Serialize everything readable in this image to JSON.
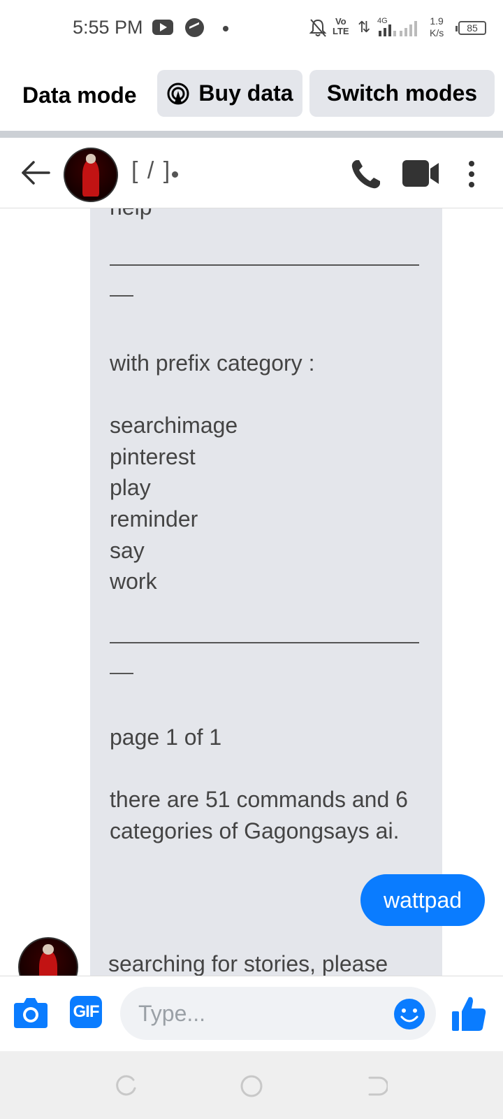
{
  "status_bar": {
    "time": "5:55 PM",
    "network_label": "Vo\nLTE",
    "network_type": "4G",
    "speed_value": "1.9",
    "speed_unit": "K/s",
    "battery": "85"
  },
  "data_mode_bar": {
    "label": "Data mode",
    "buy_data": "Buy data",
    "switch_modes": "Switch modes"
  },
  "chat_header": {
    "contact_name": "[ / ]"
  },
  "messages": {
    "bot_lines": [
      "help",
      "",
      "",
      "",
      "",
      "with prefix category :",
      "",
      "searchimage",
      "pinterest",
      "play",
      "reminder",
      "say",
      "work",
      "",
      "",
      "",
      "",
      "page 1 of 1",
      "",
      "there are 51 commands and 6",
      "categories of Gagongsays ai."
    ],
    "outgoing": "wattpad",
    "bot_reply": "searching for stories, please"
  },
  "composer": {
    "placeholder": "Type...",
    "gif_label": "GIF"
  },
  "colors": {
    "accent": "#0a7cff",
    "bubble_incoming": "#e4e6eb",
    "divider": "#ccd0d5"
  },
  "icons": [
    "youtube-icon",
    "messenger-icon",
    "bell-off-icon",
    "signal-icon",
    "battery-icon",
    "back-arrow-icon",
    "phone-icon",
    "video-icon",
    "more-vertical-icon",
    "camera-icon",
    "gif-icon",
    "emoji-icon",
    "like-icon",
    "hotspot-icon"
  ]
}
